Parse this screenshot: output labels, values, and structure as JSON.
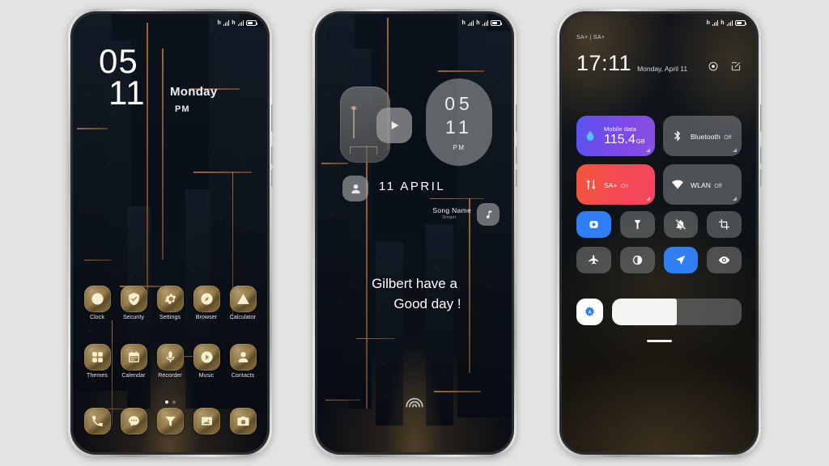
{
  "background_color": "#e4e3e1",
  "phones": [
    {
      "name": "home-screen",
      "status_bar": {
        "signal": "signal-icon",
        "battery": "battery-icon"
      },
      "clock": {
        "hour": "05",
        "minute": "11",
        "day": "Monday",
        "ampm": "PM"
      },
      "apps_row1": [
        {
          "label": "Clock",
          "icon": "clock-icon"
        },
        {
          "label": "Security",
          "icon": "shield-check-icon"
        },
        {
          "label": "Settings",
          "icon": "gear-icon"
        },
        {
          "label": "Browser",
          "icon": "compass-icon"
        },
        {
          "label": "Calculator",
          "icon": "warning-triangle-icon"
        }
      ],
      "apps_row2": [
        {
          "label": "Themes",
          "icon": "grid-squares-icon"
        },
        {
          "label": "Calendar",
          "icon": "calendar-icon"
        },
        {
          "label": "Recorder",
          "icon": "microphone-icon"
        },
        {
          "label": "Music",
          "icon": "play-circle-icon"
        },
        {
          "label": "Contacts",
          "icon": "person-icon"
        }
      ],
      "dock": [
        {
          "label": "Phone",
          "icon": "phone-handset-icon"
        },
        {
          "label": "Messages",
          "icon": "chat-bubble-icon"
        },
        {
          "label": "Cleaner",
          "icon": "funnel-icon"
        },
        {
          "label": "Gallery",
          "icon": "photo-person-icon"
        },
        {
          "label": "Camera",
          "icon": "camera-icon"
        }
      ],
      "page_dots": {
        "count": 2,
        "active_index": 0
      }
    },
    {
      "name": "lock-screen",
      "media_widget": {
        "icon": "photo-widget-icon",
        "play_icon": "play-icon"
      },
      "clock": {
        "hour": "05",
        "minute": "11",
        "ampm": "PM"
      },
      "person_icon": "person-icon",
      "date": "11 APRIL",
      "song": {
        "title": "Song Name",
        "artist": "Singer",
        "icon": "music-note-icon"
      },
      "greeting_line1": "Gilbert have a",
      "greeting_line2": "Good day !",
      "fingerprint_icon": "fingerprint-unlock-icon"
    },
    {
      "name": "quick-settings",
      "carrier": "SA+ | SA+",
      "time": "17:11",
      "date": "Monday, April 11",
      "actions": [
        {
          "name": "settings-icon"
        },
        {
          "name": "edit-icon"
        }
      ],
      "big_tiles": [
        {
          "title": "Mobile data",
          "value": "115.4",
          "unit": "GB",
          "state": "",
          "icon": "water-drop-icon",
          "style": "data",
          "accent": "#6b52ee"
        },
        {
          "title": "Bluetooth",
          "value": "",
          "unit": "",
          "state": "Off",
          "icon": "bluetooth-icon",
          "style": "off",
          "accent": "#7e8082"
        },
        {
          "title": "SA+",
          "value": "",
          "unit": "",
          "state": "On",
          "icon": "data-transfer-icon",
          "style": "sa",
          "accent": "#f44a55"
        },
        {
          "title": "WLAN",
          "value": "",
          "unit": "",
          "state": "Off",
          "icon": "wifi-icon",
          "style": "off",
          "accent": "#7e8082"
        }
      ],
      "small_tiles": [
        {
          "name": "screen-record-icon",
          "active": true
        },
        {
          "name": "flashlight-icon",
          "active": false
        },
        {
          "name": "bell-mute-icon",
          "active": false
        },
        {
          "name": "screenshot-crop-icon",
          "active": false
        },
        {
          "name": "airplane-mode-icon",
          "active": false
        },
        {
          "name": "dark-mode-icon",
          "active": false
        },
        {
          "name": "location-arrow-icon",
          "active": true
        },
        {
          "name": "eye-reading-mode-icon",
          "active": false
        }
      ],
      "brightness": {
        "auto_icon": "auto-brightness-icon",
        "level_percent": 50
      }
    }
  ]
}
